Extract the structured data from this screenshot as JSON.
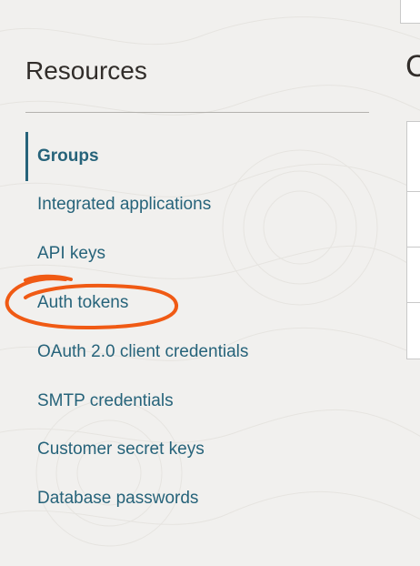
{
  "sidebar": {
    "title": "Resources",
    "items": [
      {
        "label": "Groups",
        "active": true
      },
      {
        "label": "Integrated applications",
        "active": false
      },
      {
        "label": "API keys",
        "active": false
      },
      {
        "label": "Auth tokens",
        "active": false,
        "highlighted": true
      },
      {
        "label": "OAuth 2.0 client credentials",
        "active": false
      },
      {
        "label": "SMTP credentials",
        "active": false
      },
      {
        "label": "Customer secret keys",
        "active": false
      },
      {
        "label": "Database passwords",
        "active": false
      }
    ]
  },
  "main": {
    "heading_partial": "C"
  },
  "colors": {
    "background": "#f1f0ee",
    "link": "#26637a",
    "title_text": "#312d2a",
    "annotation": "#f05a14"
  }
}
